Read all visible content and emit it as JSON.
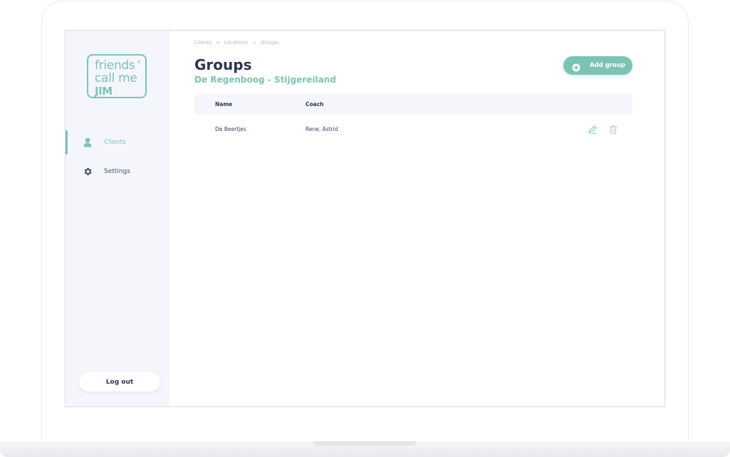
{
  "colors": {
    "accent": "#7cc3b6",
    "heading": "#2f3452",
    "sidebar_bg": "#f5f6fb",
    "muted": "#b4b7c6"
  },
  "logo": {
    "line1": "friends",
    "line2": "call me",
    "line3": "JIM",
    "registered": "®"
  },
  "sidebar": {
    "items": [
      {
        "label": "Clients",
        "icon": "user-icon",
        "active": true
      },
      {
        "label": "Settings",
        "icon": "gear-icon",
        "active": false
      }
    ],
    "logout_label": "Log out"
  },
  "breadcrumb": {
    "items": [
      "Clients",
      "Locations",
      "Groups"
    ],
    "separator": ">"
  },
  "page": {
    "title": "Groups",
    "subtitle": "De Regenboog - Stijgereiland"
  },
  "toolbar": {
    "add_label": "Add group",
    "add_icon": "plus-circle-icon"
  },
  "table": {
    "columns": [
      "Name",
      "Coach"
    ],
    "rows": [
      {
        "name": "De Beertjes",
        "coach": "Rene, Astrid",
        "actions": [
          "pencil-icon",
          "trash-icon"
        ]
      }
    ]
  }
}
